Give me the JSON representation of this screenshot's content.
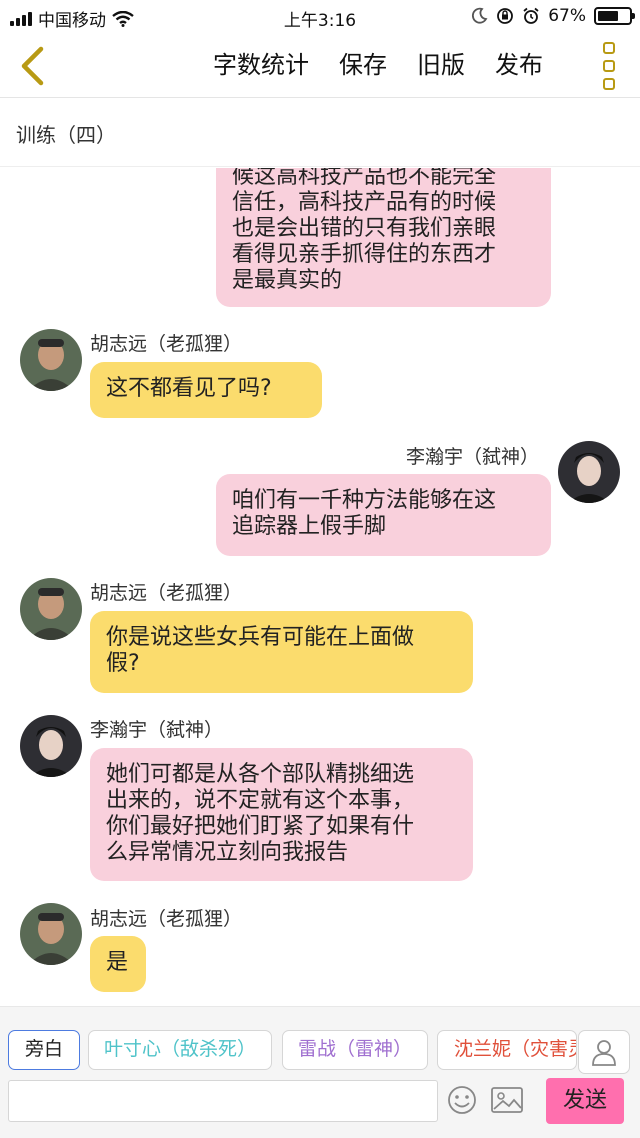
{
  "status_bar": {
    "carrier": "中国移动",
    "time": "上午3:16",
    "battery": "67%",
    "battery_level": 0.67
  },
  "nav": {
    "actions": [
      "字数统计",
      "保存",
      "旧版",
      "发布"
    ],
    "accent_color": "#b89a14"
  },
  "title": "训练（四）",
  "messages": [
    {
      "speaker": "",
      "side": "right",
      "text_lines": [
        "候这高科技产品也不能完全",
        "信任，高科技产品有的时候",
        "也是会出错的只有我们亲眼",
        "看得见亲手抓得住的东西才",
        "是最真实的"
      ]
    },
    {
      "speaker": "胡志远（老孤狸）",
      "side": "left",
      "text_lines": [
        "这不都看见了吗?"
      ]
    },
    {
      "speaker": "李瀚宇（弑神）",
      "side": "right",
      "text_lines": [
        "咱们有一千种方法能够在这",
        "追踪器上假手脚"
      ]
    },
    {
      "speaker": "胡志远（老孤狸）",
      "side": "left",
      "text_lines": [
        "你是说这些女兵有可能在上面做",
        "假?"
      ]
    },
    {
      "speaker": "李瀚宇（弑神）",
      "side": "left",
      "text_lines": [
        "她们可都是从各个部队精挑细选",
        "出来的，说不定就有这个本事，",
        "你们最好把她们盯紧了如果有什",
        "么异常情况立刻向我报告"
      ]
    },
    {
      "speaker": "胡志远（老孤狸）",
      "side": "left",
      "text_lines": [
        "是"
      ]
    }
  ],
  "roles": [
    {
      "label": "旁白",
      "color": "#222222",
      "active": true
    },
    {
      "label": "叶寸心（敌杀死）",
      "color": "#4fc3c9",
      "active": false
    },
    {
      "label": "雷战（雷神）",
      "color": "#a070d0",
      "active": false
    },
    {
      "label": "沈兰妮（灾害灵",
      "color": "#e0503a",
      "active": false
    }
  ],
  "input": {
    "placeholder": "",
    "send_label": "发送"
  },
  "icons": [
    "back-chevron-icon",
    "more-dots-icon",
    "person-icon",
    "emoji-icon",
    "image-icon"
  ]
}
